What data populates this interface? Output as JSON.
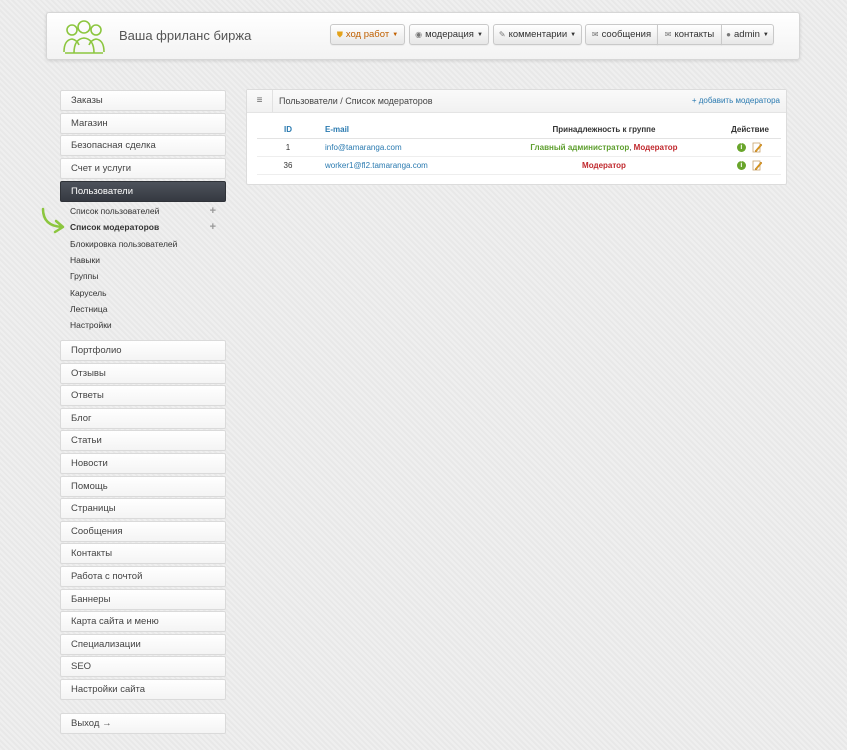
{
  "header": {
    "brand": "Ваша фриланс биржа",
    "nav": [
      {
        "label": "ход работ",
        "icon": "shield-icon",
        "caret": true,
        "warn": true
      },
      {
        "label": "модерация",
        "icon": "eye-icon",
        "caret": true
      },
      {
        "label": "комментарии",
        "icon": "pencil-icon",
        "caret": true
      },
      {
        "label": "сообщения",
        "icon": "envelope-icon"
      },
      {
        "label": "контакты",
        "icon": "envelope-icon"
      },
      {
        "label": "admin",
        "icon": "user-icon",
        "caret": true
      }
    ]
  },
  "sidebar": {
    "top_items": [
      "Заказы",
      "Магазин",
      "Безопасная сделка",
      "Счет и услуги"
    ],
    "active_item": "Пользователи",
    "sub_items": [
      {
        "label": "Список пользователей",
        "plus": true
      },
      {
        "label": "Список модераторов",
        "plus": true,
        "current": true
      },
      {
        "label": "Блокировка пользователей"
      },
      {
        "label": "Навыки"
      },
      {
        "label": "Группы"
      },
      {
        "label": "Карусель"
      },
      {
        "label": "Лестница"
      },
      {
        "label": "Настройки"
      }
    ],
    "bottom_items": [
      "Портфолио",
      "Отзывы",
      "Ответы",
      "Блог",
      "Статьи",
      "Новости",
      "Помощь",
      "Страницы",
      "Сообщения",
      "Контакты",
      "Работа с почтой",
      "Баннеры",
      "Карта сайта и меню",
      "Специализации",
      "SEO",
      "Настройки сайта"
    ],
    "logout": "Выход →",
    "plus_glyph": "+"
  },
  "panel": {
    "breadcrumb": "Пользователи / Список модераторов",
    "add_link": "+ добавить модератора",
    "columns": [
      "ID",
      "E-mail",
      "Принадлежность к группе",
      "Действие"
    ],
    "rows": [
      {
        "id": "1",
        "email": "info@tamaranga.com",
        "group_admin": "Главный администратор",
        "sep": ", ",
        "group_mod": "Модератор"
      },
      {
        "id": "36",
        "email": "worker1@fl2.tamaranga.com",
        "group_admin": "",
        "sep": "",
        "group_mod": "Модератор"
      }
    ]
  },
  "icons": {
    "shield-icon": "⛊",
    "eye-icon": "◉",
    "pencil-icon": "✎",
    "envelope-icon": "✉",
    "user-icon": "●",
    "caret": "▼",
    "menu": "≡",
    "info": "i"
  },
  "colors": {
    "active_bg": "#3f434b",
    "link": "#2a7ab0",
    "green": "#5d9e2d",
    "red": "#c0282d",
    "arrow": "#8cc63f"
  }
}
